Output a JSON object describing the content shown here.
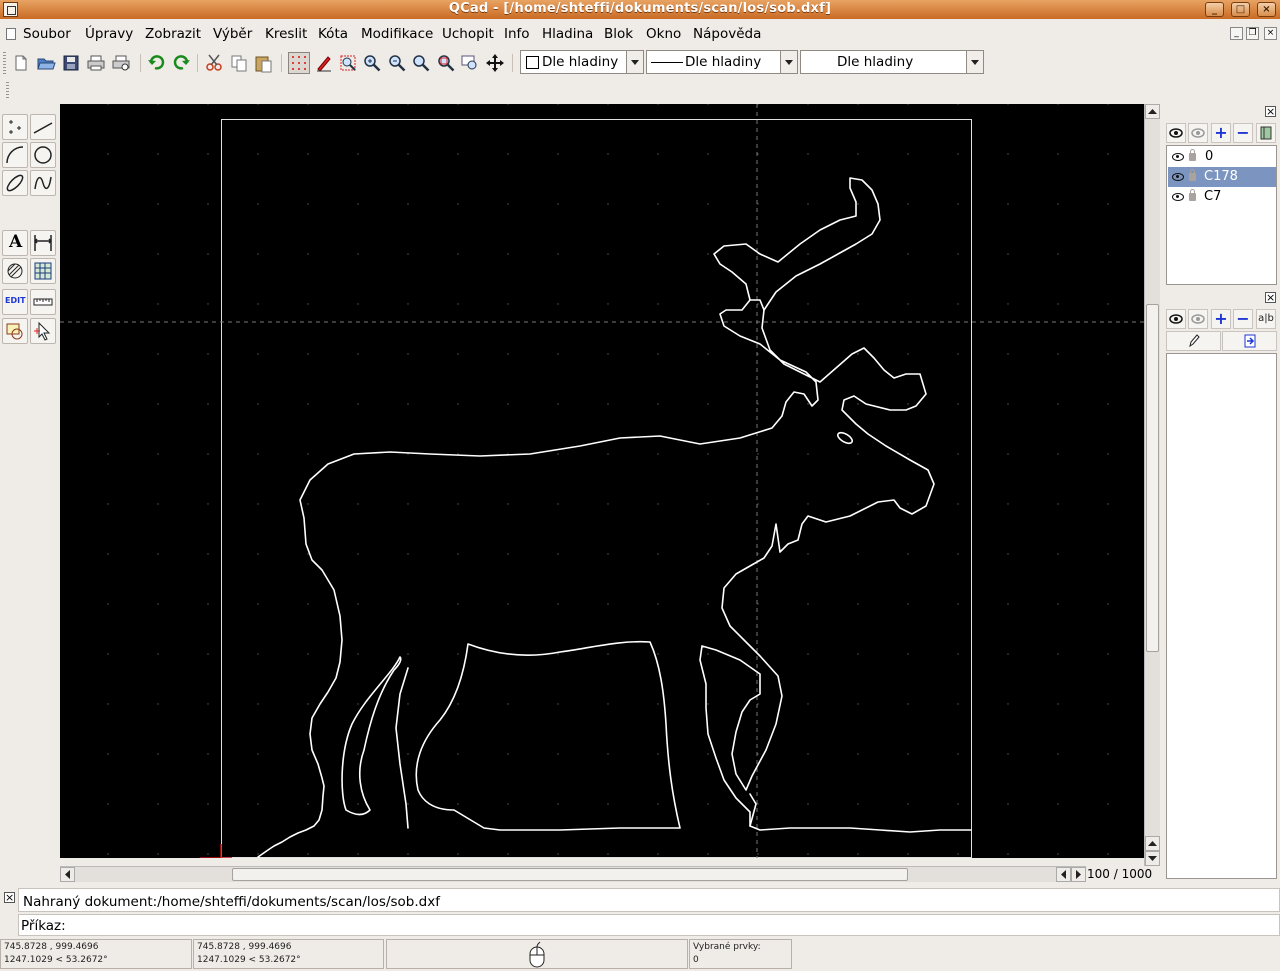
{
  "window": {
    "title": "QCad - [/home/shteffi/dokuments/scan/los/sob.dxf]",
    "controls": {
      "minimize": "_",
      "maximize": "□",
      "close": "×"
    }
  },
  "menu": {
    "items": [
      "Soubor",
      "Úpravy",
      "Zobrazit",
      "Výběr",
      "Kreslit",
      "Kóta",
      "Modifikace",
      "Uchopit",
      "Info",
      "Hladina",
      "Blok",
      "Okno",
      "Nápověda"
    ]
  },
  "mdi_controls": {
    "minimize": "_",
    "restore": "❐",
    "close": "×"
  },
  "toolbar": {
    "color_combo": "Dle hladiny",
    "linetype_combo": "Dle hladiny",
    "width_combo": "Dle hladiny"
  },
  "left_tools": {
    "text_tool": "A",
    "edit_tool": "EDIT"
  },
  "zoom_info": "100 / 1000",
  "layers": {
    "items": [
      {
        "name": "0",
        "selected": false
      },
      {
        "name": "C178",
        "selected": true
      },
      {
        "name": "C7",
        "selected": false
      }
    ],
    "add": "+",
    "remove": "−"
  },
  "blocks": {
    "add": "+",
    "remove": "−",
    "attrib": "a|b"
  },
  "command": {
    "history": "Nahraný dokument:/home/shteffi/dokuments/scan/los/sob.dxf",
    "prompt": "Příkaz:"
  },
  "status": {
    "abs_coord": "745.8728 , 999.4696",
    "abs_polar": "1247.1029 < 53.2672°",
    "rel_coord": "745.8728 , 999.4696",
    "rel_polar": "1247.1029 < 53.2672°",
    "selected_label": "Vybrané prvky:",
    "selected_count": "0"
  },
  "colors": {
    "titlebar": "#c96a24",
    "selection": "#7b95c0",
    "canvas": "#000000",
    "drawing": "#ffffff"
  }
}
